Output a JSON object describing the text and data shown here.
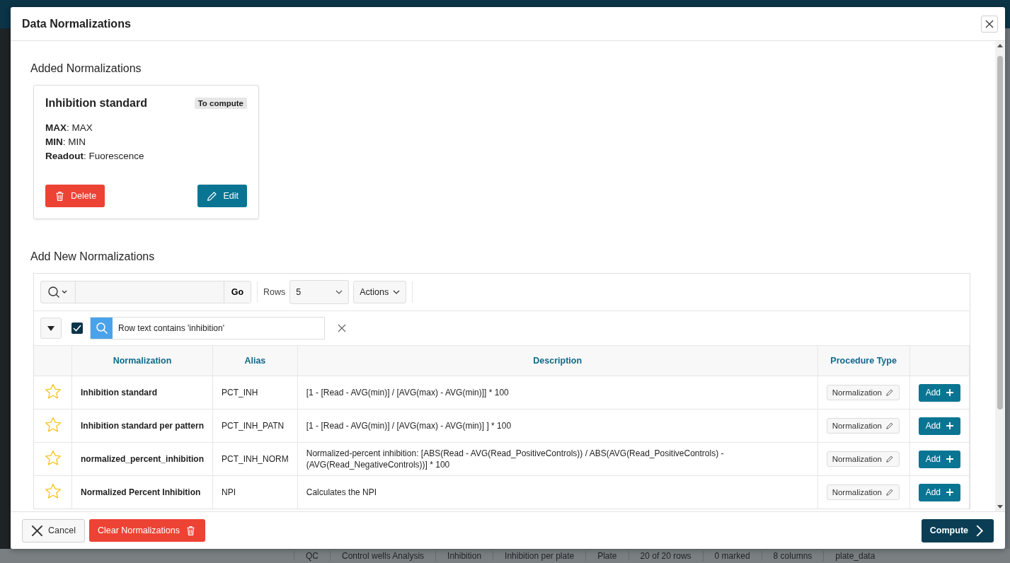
{
  "dialog": {
    "title": "Data Normalizations"
  },
  "added": {
    "heading": "Added Normalizations",
    "cards": [
      {
        "title": "Inhibition standard",
        "badge": "To compute",
        "fields": [
          "**MAX**: MAX",
          "**MIN**: MIN",
          "**Readout**: Fuorescence"
        ],
        "delete_label": "Delete",
        "edit_label": "Edit"
      }
    ]
  },
  "add_new": {
    "heading": "Add New Normalizations",
    "toolbar": {
      "go_label": "Go",
      "rows_label": "Rows",
      "rows_value": "5",
      "actions_label": "Actions"
    },
    "filter": {
      "enabled": true,
      "text": "Row text contains 'inhibition'"
    },
    "table": {
      "columns": [
        "Normalization",
        "Alias",
        "Description",
        "Procedure Type"
      ],
      "rows": [
        {
          "favorite": false,
          "name": "Inhibition standard",
          "alias": "PCT_INH",
          "description": "[1 - [Read - AVG(min)] / [AVG(max) - AVG(min)]] * 100",
          "procedure_type": "Normalization",
          "action": "Add"
        },
        {
          "favorite": false,
          "name": "Inhibition standard per pattern",
          "alias": "PCT_INH_PATN",
          "description": "[1 - [Read - AVG(min)] / [AVG(max) - AVG(min)] ] * 100",
          "procedure_type": "Normalization",
          "action": "Add"
        },
        {
          "favorite": false,
          "name": "normalized_percent_inhibition",
          "alias": "PCT_INH_NORM",
          "description": "Normalized-percent inhibition: [ABS(Read - AVG(Read_PositiveControls)) / ABS(AVG(Read_PositiveControls) - (AVG(Read_NegativeControls))] * 100",
          "procedure_type": "Normalization",
          "action": "Add"
        },
        {
          "favorite": false,
          "name": "Normalized Percent Inhibition",
          "alias": "NPI",
          "description": "Calculates the NPI",
          "procedure_type": "Normalization",
          "action": "Add"
        }
      ]
    }
  },
  "footer": {
    "cancel_label": "Cancel",
    "clear_label": "Clear Normalizations",
    "compute_label": "Compute"
  },
  "status_bar": [
    "QC",
    "Control wells Analysis",
    "Inhibition",
    "Inhibition per plate",
    "Plate",
    "20 of 20 rows",
    "0 marked",
    "8 columns",
    "plate_data"
  ]
}
